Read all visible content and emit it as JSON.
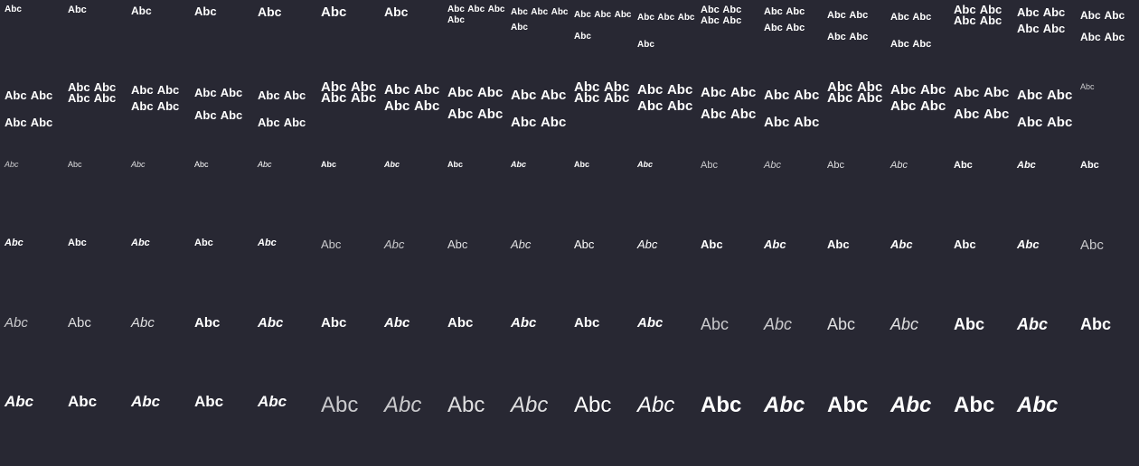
{
  "sample_text": "Abc",
  "background_color": "#282833",
  "text_color": "#ffffff",
  "specimens": [
    {
      "text": "Abc",
      "size": 10,
      "line": 1.2,
      "weight": 700,
      "style": "normal",
      "opacity": 1
    },
    {
      "text": "Abc",
      "size": 11,
      "line": 1.2,
      "weight": 700,
      "style": "normal",
      "opacity": 1
    },
    {
      "text": "Abc",
      "size": 12,
      "line": 1.2,
      "weight": 700,
      "style": "normal",
      "opacity": 1
    },
    {
      "text": "Abc",
      "size": 13,
      "line": 1.2,
      "weight": 700,
      "style": "normal",
      "opacity": 1
    },
    {
      "text": "Abc",
      "size": 14,
      "line": 1.2,
      "weight": 700,
      "style": "normal",
      "opacity": 1
    },
    {
      "text": "Abc",
      "size": 15,
      "line": 1.2,
      "weight": 700,
      "style": "normal",
      "opacity": 1
    },
    {
      "text": "Abc",
      "size": 14,
      "line": 1.2,
      "weight": 700,
      "style": "normal",
      "opacity": 1
    },
    {
      "text": "Abc Abc Abc Abc",
      "size": 10,
      "line": 1.2,
      "weight": 700,
      "style": "normal",
      "opacity": 1
    },
    {
      "text": "Abc Abc Abc Abc",
      "size": 10,
      "line": 1.7,
      "weight": 700,
      "style": "normal",
      "opacity": 1
    },
    {
      "text": "Abc Abc Abc Abc",
      "size": 10,
      "line": 2.4,
      "weight": 700,
      "style": "normal",
      "opacity": 1
    },
    {
      "text": "Abc Abc Abc Abc",
      "size": 10,
      "line": 3.0,
      "weight": 700,
      "style": "normal",
      "opacity": 1
    },
    {
      "text": "Abc Abc Abc Abc",
      "size": 11,
      "line": 1.1,
      "weight": 700,
      "style": "normal",
      "opacity": 1
    },
    {
      "text": "Abc Abc Abc Abc",
      "size": 11,
      "line": 1.6,
      "weight": 700,
      "style": "normal",
      "opacity": 1
    },
    {
      "text": "Abc Abc Abc Abc",
      "size": 11,
      "line": 2.2,
      "weight": 700,
      "style": "normal",
      "opacity": 1
    },
    {
      "text": "Abc Abc Abc Abc",
      "size": 11,
      "line": 2.7,
      "weight": 700,
      "style": "normal",
      "opacity": 1
    },
    {
      "text": "Abc Abc Abc Abc",
      "size": 13,
      "line": 0.9,
      "weight": 700,
      "style": "normal",
      "opacity": 1
    },
    {
      "text": "Abc Abc Abc Abc",
      "size": 13,
      "line": 1.4,
      "weight": 700,
      "style": "normal",
      "opacity": 1
    },
    {
      "text": "Abc Abc Abc Abc",
      "size": 12,
      "line": 2.0,
      "weight": 700,
      "style": "normal",
      "opacity": 1
    },
    {
      "text": "Abc Abc Abc Abc",
      "size": 13,
      "line": 2.3,
      "weight": 700,
      "style": "normal",
      "opacity": 1
    },
    {
      "text": "Abc Abc Abc Abc",
      "size": 13,
      "line": 0.9,
      "weight": 700,
      "style": "normal",
      "opacity": 1
    },
    {
      "text": "Abc Abc Abc Abc",
      "size": 13,
      "line": 1.4,
      "weight": 700,
      "style": "normal",
      "opacity": 1
    },
    {
      "text": "Abc Abc Abc Abc",
      "size": 13,
      "line": 1.9,
      "weight": 700,
      "style": "normal",
      "opacity": 1
    },
    {
      "text": "Abc Abc Abc Abc",
      "size": 13,
      "line": 2.3,
      "weight": 700,
      "style": "normal",
      "opacity": 1
    },
    {
      "text": "Abc Abc Abc Abc",
      "size": 15,
      "line": 0.8,
      "weight": 700,
      "style": "normal",
      "opacity": 1
    },
    {
      "text": "Abc Abc Abc Abc",
      "size": 15,
      "line": 1.2,
      "weight": 700,
      "style": "normal",
      "opacity": 1
    },
    {
      "text": "Abc Abc Abc Abc",
      "size": 15,
      "line": 1.6,
      "weight": 700,
      "style": "normal",
      "opacity": 1
    },
    {
      "text": "Abc Abc Abc Abc",
      "size": 15,
      "line": 2.0,
      "weight": 700,
      "style": "normal",
      "opacity": 1
    },
    {
      "text": "Abc Abc Abc Abc",
      "size": 15,
      "line": 0.8,
      "weight": 700,
      "style": "normal",
      "opacity": 1
    },
    {
      "text": "Abc Abc Abc Abc",
      "size": 15,
      "line": 1.2,
      "weight": 700,
      "style": "normal",
      "opacity": 1
    },
    {
      "text": "Abc Abc Abc Abc",
      "size": 15,
      "line": 1.6,
      "weight": 700,
      "style": "normal",
      "opacity": 1
    },
    {
      "text": "Abc Abc Abc Abc",
      "size": 15,
      "line": 2.0,
      "weight": 700,
      "style": "normal",
      "opacity": 1
    },
    {
      "text": "Abc Abc Abc Abc",
      "size": 15,
      "line": 0.8,
      "weight": 700,
      "style": "normal",
      "opacity": 1
    },
    {
      "text": "Abc Abc Abc Abc",
      "size": 15,
      "line": 1.2,
      "weight": 700,
      "style": "normal",
      "opacity": 1
    },
    {
      "text": "Abc Abc Abc Abc",
      "size": 15,
      "line": 1.6,
      "weight": 700,
      "style": "normal",
      "opacity": 1
    },
    {
      "text": "Abc Abc Abc Abc",
      "size": 15,
      "line": 2.0,
      "weight": 700,
      "style": "normal",
      "opacity": 1
    },
    {
      "text": "Abc",
      "size": 9,
      "line": 1.2,
      "weight": 400,
      "style": "normal",
      "opacity": 0.75
    },
    {
      "text": "Abc",
      "size": 9,
      "line": 1.2,
      "weight": 400,
      "style": "italic",
      "opacity": 0.75
    },
    {
      "text": "Abc",
      "size": 9,
      "line": 1.2,
      "weight": 400,
      "style": "normal",
      "opacity": 0.85
    },
    {
      "text": "Abc",
      "size": 9,
      "line": 1.2,
      "weight": 400,
      "style": "italic",
      "opacity": 0.85
    },
    {
      "text": "Abc",
      "size": 9,
      "line": 1.2,
      "weight": 400,
      "style": "normal",
      "opacity": 1
    },
    {
      "text": "Abc",
      "size": 9,
      "line": 1.2,
      "weight": 400,
      "style": "italic",
      "opacity": 1
    },
    {
      "text": "Abc",
      "size": 9,
      "line": 1.2,
      "weight": 700,
      "style": "normal",
      "opacity": 1
    },
    {
      "text": "Abc",
      "size": 9,
      "line": 1.2,
      "weight": 700,
      "style": "italic",
      "opacity": 1
    },
    {
      "text": "Abc",
      "size": 9,
      "line": 1.2,
      "weight": 700,
      "style": "normal",
      "opacity": 1
    },
    {
      "text": "Abc",
      "size": 9,
      "line": 1.2,
      "weight": 700,
      "style": "italic",
      "opacity": 1
    },
    {
      "text": "Abc",
      "size": 9,
      "line": 1.2,
      "weight": 700,
      "style": "normal",
      "opacity": 1
    },
    {
      "text": "Abc",
      "size": 9,
      "line": 1.2,
      "weight": 700,
      "style": "italic",
      "opacity": 1
    },
    {
      "text": "Abc",
      "size": 11,
      "line": 1.2,
      "weight": 400,
      "style": "normal",
      "opacity": 0.75
    },
    {
      "text": "Abc",
      "size": 11,
      "line": 1.2,
      "weight": 400,
      "style": "italic",
      "opacity": 0.75
    },
    {
      "text": "Abc",
      "size": 11,
      "line": 1.2,
      "weight": 400,
      "style": "normal",
      "opacity": 0.85
    },
    {
      "text": "Abc",
      "size": 11,
      "line": 1.2,
      "weight": 400,
      "style": "italic",
      "opacity": 0.85
    },
    {
      "text": "Abc",
      "size": 11,
      "line": 1.2,
      "weight": 700,
      "style": "normal",
      "opacity": 1
    },
    {
      "text": "Abc",
      "size": 11,
      "line": 1.2,
      "weight": 700,
      "style": "italic",
      "opacity": 1
    },
    {
      "text": "Abc",
      "size": 11,
      "line": 1.2,
      "weight": 700,
      "style": "normal",
      "opacity": 1
    },
    {
      "text": "Abc",
      "size": 11,
      "line": 1.2,
      "weight": 700,
      "style": "italic",
      "opacity": 1
    },
    {
      "text": "Abc",
      "size": 11,
      "line": 1.2,
      "weight": 700,
      "style": "normal",
      "opacity": 1
    },
    {
      "text": "Abc",
      "size": 11,
      "line": 1.2,
      "weight": 700,
      "style": "italic",
      "opacity": 1
    },
    {
      "text": "Abc",
      "size": 11,
      "line": 1.2,
      "weight": 700,
      "style": "normal",
      "opacity": 1
    },
    {
      "text": "Abc",
      "size": 11,
      "line": 1.2,
      "weight": 700,
      "style": "italic",
      "opacity": 1
    },
    {
      "text": "Abc",
      "size": 13,
      "line": 1.2,
      "weight": 400,
      "style": "normal",
      "opacity": 0.75
    },
    {
      "text": "Abc",
      "size": 13,
      "line": 1.2,
      "weight": 400,
      "style": "italic",
      "opacity": 0.75
    },
    {
      "text": "Abc",
      "size": 13,
      "line": 1.2,
      "weight": 400,
      "style": "normal",
      "opacity": 0.85
    },
    {
      "text": "Abc",
      "size": 13,
      "line": 1.2,
      "weight": 400,
      "style": "italic",
      "opacity": 0.85
    },
    {
      "text": "Abc",
      "size": 13,
      "line": 1.2,
      "weight": 400,
      "style": "normal",
      "opacity": 1
    },
    {
      "text": "Abc",
      "size": 13,
      "line": 1.2,
      "weight": 400,
      "style": "italic",
      "opacity": 1
    },
    {
      "text": "Abc",
      "size": 13,
      "line": 1.2,
      "weight": 700,
      "style": "normal",
      "opacity": 1
    },
    {
      "text": "Abc",
      "size": 13,
      "line": 1.2,
      "weight": 700,
      "style": "italic",
      "opacity": 1
    },
    {
      "text": "Abc",
      "size": 13,
      "line": 1.2,
      "weight": 700,
      "style": "normal",
      "opacity": 1
    },
    {
      "text": "Abc",
      "size": 13,
      "line": 1.2,
      "weight": 700,
      "style": "italic",
      "opacity": 1
    },
    {
      "text": "Abc",
      "size": 13,
      "line": 1.2,
      "weight": 700,
      "style": "normal",
      "opacity": 1
    },
    {
      "text": "Abc",
      "size": 13,
      "line": 1.2,
      "weight": 700,
      "style": "italic",
      "opacity": 1
    },
    {
      "text": "Abc",
      "size": 15,
      "line": 1.2,
      "weight": 400,
      "style": "normal",
      "opacity": 0.75
    },
    {
      "text": "Abc",
      "size": 15,
      "line": 1.2,
      "weight": 400,
      "style": "italic",
      "opacity": 0.75
    },
    {
      "text": "Abc",
      "size": 15,
      "line": 1.2,
      "weight": 400,
      "style": "normal",
      "opacity": 0.85
    },
    {
      "text": "Abc",
      "size": 15,
      "line": 1.2,
      "weight": 400,
      "style": "italic",
      "opacity": 0.85
    },
    {
      "text": "Abc",
      "size": 15,
      "line": 1.2,
      "weight": 700,
      "style": "normal",
      "opacity": 1
    },
    {
      "text": "Abc",
      "size": 15,
      "line": 1.2,
      "weight": 700,
      "style": "italic",
      "opacity": 1
    },
    {
      "text": "Abc",
      "size": 15,
      "line": 1.2,
      "weight": 700,
      "style": "normal",
      "opacity": 1
    },
    {
      "text": "Abc",
      "size": 15,
      "line": 1.2,
      "weight": 700,
      "style": "italic",
      "opacity": 1
    },
    {
      "text": "Abc",
      "size": 15,
      "line": 1.2,
      "weight": 700,
      "style": "normal",
      "opacity": 1
    },
    {
      "text": "Abc",
      "size": 15,
      "line": 1.2,
      "weight": 700,
      "style": "italic",
      "opacity": 1
    },
    {
      "text": "Abc",
      "size": 15,
      "line": 1.2,
      "weight": 700,
      "style": "normal",
      "opacity": 1
    },
    {
      "text": "Abc",
      "size": 15,
      "line": 1.2,
      "weight": 700,
      "style": "italic",
      "opacity": 1
    },
    {
      "text": "Abc",
      "size": 18,
      "line": 1.2,
      "weight": 400,
      "style": "normal",
      "opacity": 0.75
    },
    {
      "text": "Abc",
      "size": 18,
      "line": 1.2,
      "weight": 400,
      "style": "italic",
      "opacity": 0.75
    },
    {
      "text": "Abc",
      "size": 18,
      "line": 1.2,
      "weight": 400,
      "style": "normal",
      "opacity": 0.85
    },
    {
      "text": "Abc",
      "size": 18,
      "line": 1.2,
      "weight": 400,
      "style": "italic",
      "opacity": 0.85
    },
    {
      "text": "Abc",
      "size": 18,
      "line": 1.2,
      "weight": 700,
      "style": "normal",
      "opacity": 1
    },
    {
      "text": "Abc",
      "size": 18,
      "line": 1.2,
      "weight": 700,
      "style": "italic",
      "opacity": 1
    },
    {
      "text": "Abc",
      "size": 18,
      "line": 1.2,
      "weight": 700,
      "style": "normal",
      "opacity": 1
    },
    {
      "text": "Abc",
      "size": 17,
      "line": 1.2,
      "weight": 700,
      "style": "italic",
      "opacity": 1
    },
    {
      "text": "Abc",
      "size": 17,
      "line": 1.2,
      "weight": 700,
      "style": "normal",
      "opacity": 1
    },
    {
      "text": "Abc",
      "size": 17,
      "line": 1.2,
      "weight": 700,
      "style": "italic",
      "opacity": 1
    },
    {
      "text": "Abc",
      "size": 17,
      "line": 1.2,
      "weight": 700,
      "style": "normal",
      "opacity": 1
    },
    {
      "text": "Abc",
      "size": 17,
      "line": 1.2,
      "weight": 700,
      "style": "italic",
      "opacity": 1
    },
    {
      "text": "Abc",
      "size": 24,
      "line": 1.2,
      "weight": 400,
      "style": "normal",
      "opacity": 0.75
    },
    {
      "text": "Abc",
      "size": 24,
      "line": 1.2,
      "weight": 400,
      "style": "italic",
      "opacity": 0.75
    },
    {
      "text": "Abc",
      "size": 24,
      "line": 1.2,
      "weight": 400,
      "style": "normal",
      "opacity": 0.85
    },
    {
      "text": "Abc",
      "size": 24,
      "line": 1.2,
      "weight": 400,
      "style": "italic",
      "opacity": 0.85
    },
    {
      "text": "Abc",
      "size": 24,
      "line": 1.2,
      "weight": 400,
      "style": "normal",
      "opacity": 1
    },
    {
      "text": "Abc",
      "size": 24,
      "line": 1.2,
      "weight": 400,
      "style": "italic",
      "opacity": 1
    },
    {
      "text": "Abc",
      "size": 24,
      "line": 1.2,
      "weight": 700,
      "style": "normal",
      "opacity": 1
    },
    {
      "text": "Abc",
      "size": 24,
      "line": 1.2,
      "weight": 700,
      "style": "italic",
      "opacity": 1
    },
    {
      "text": "Abc",
      "size": 24,
      "line": 1.2,
      "weight": 700,
      "style": "normal",
      "opacity": 1
    },
    {
      "text": "Abc",
      "size": 24,
      "line": 1.2,
      "weight": 700,
      "style": "italic",
      "opacity": 1
    },
    {
      "text": "Abc",
      "size": 24,
      "line": 1.2,
      "weight": 700,
      "style": "normal",
      "opacity": 1
    },
    {
      "text": "Abc",
      "size": 24,
      "line": 1.2,
      "weight": 700,
      "style": "italic",
      "opacity": 1
    }
  ]
}
